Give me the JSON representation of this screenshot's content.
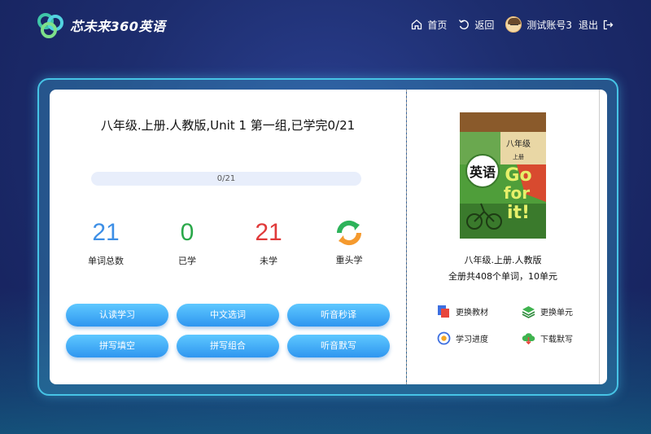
{
  "brand": {
    "name": "芯未来360英语",
    "color": "#3fc6a8"
  },
  "nav": {
    "home": "首页",
    "back": "返回",
    "account": "测试账号3",
    "logout": "退出"
  },
  "lesson": {
    "title": "八年级.上册.人教版,Unit 1 第一组,已学完0/21",
    "progress_text": "0/21",
    "progress_fraction": 0
  },
  "stats": [
    {
      "value": "21",
      "label": "单词总数",
      "color": "#3d8fe6"
    },
    {
      "value": "0",
      "label": "已学",
      "color": "#2aa84a"
    },
    {
      "value": "21",
      "label": "未学",
      "color": "#e03a3a"
    }
  ],
  "restart": {
    "label": "重头学",
    "icon": "refresh-icon"
  },
  "modes": [
    "认读学习",
    "中文选词",
    "听音秒译",
    "拼写填空",
    "拼写组合",
    "听音默写"
  ],
  "book": {
    "cover_grade": "八年级",
    "cover_term": "上册",
    "cover_subject": "英语",
    "cover_slogan": [
      "Go",
      "for",
      "it!"
    ],
    "name": "八年级.上册.人教版",
    "info": "全册共408个单词，10单元"
  },
  "actions": [
    {
      "label": "更换教材",
      "icon": "book-swap-icon"
    },
    {
      "label": "更换单元",
      "icon": "layers-icon"
    },
    {
      "label": "学习进度",
      "icon": "progress-icon"
    },
    {
      "label": "下载默写",
      "icon": "cloud-download-icon"
    }
  ]
}
